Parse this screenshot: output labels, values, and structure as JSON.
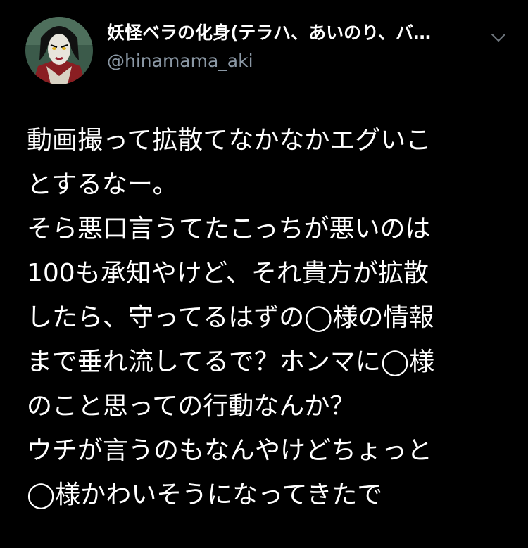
{
  "author": {
    "display_name": "妖怪ベラの化身(テラハ、あいのり、バ…",
    "handle": "@hinamama_aki",
    "avatar_icon": "anime-character-avatar-icon"
  },
  "menu": {
    "icon": "chevron-down-icon"
  },
  "tweet": {
    "lines": [
      "動画撮って拡散てなかなかエグいこ",
      "とするなー。",
      "そら悪口言うてたこっちが悪いのは",
      "100も承知やけど、それ貴方が拡散",
      "したら、守ってるはずの◯様の情報",
      "まで垂れ流してるで？ホンマに◯様",
      "のこと思っての行動なんか？",
      "ウチが言うのもなんやけどちょっと",
      "◯様かわいそうになってきたで"
    ]
  },
  "colors": {
    "background": "#000000",
    "text_primary": "#ffffff",
    "text_secondary": "#8b98a5"
  }
}
